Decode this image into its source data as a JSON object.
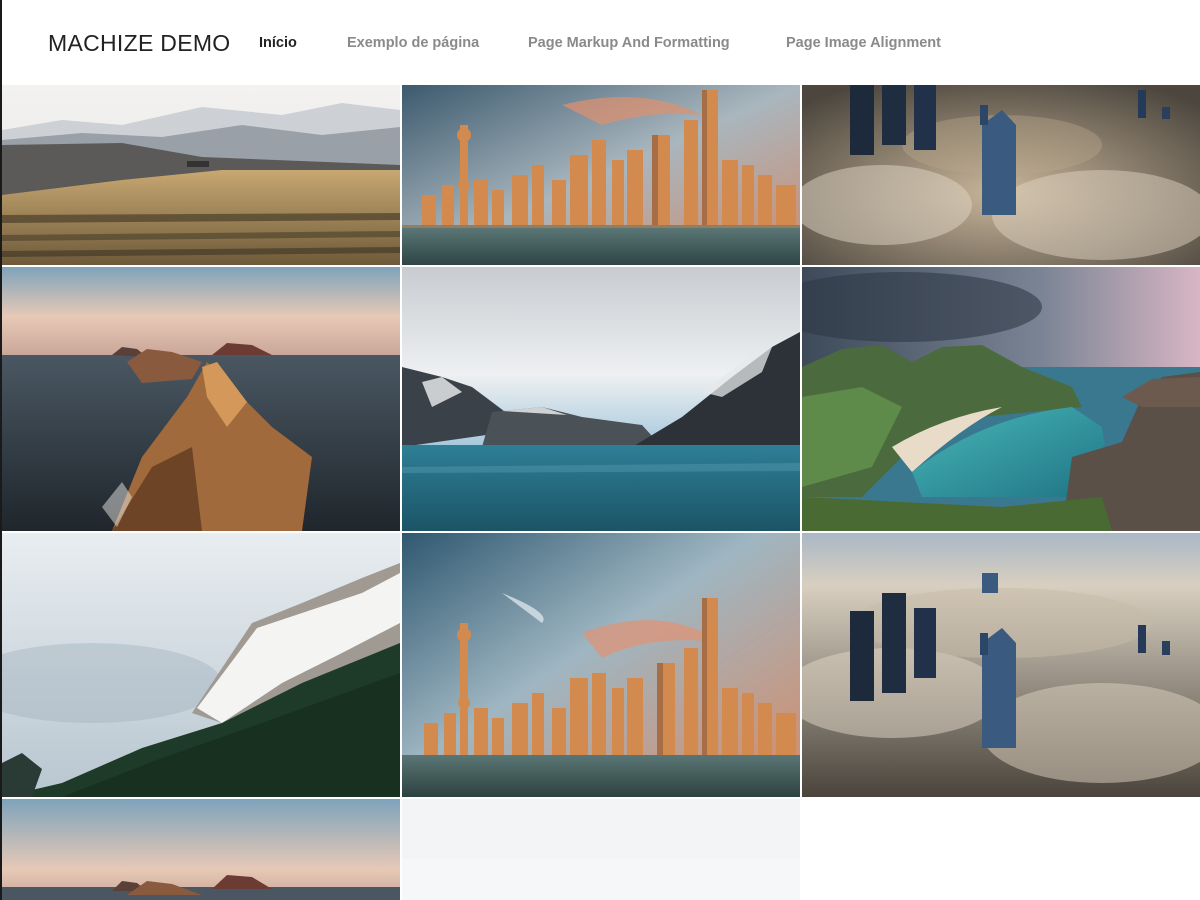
{
  "site": {
    "title": "MACHIZE DEMO"
  },
  "nav": {
    "items": [
      {
        "label": "Início",
        "active": true
      },
      {
        "label": "Exemplo de página",
        "active": false
      },
      {
        "label": "Page Markup And Formatting",
        "active": false
      },
      {
        "label": "Page Image Alignment",
        "active": false
      }
    ]
  },
  "gallery": {
    "tiles": [
      {
        "subject": "mountain meadow with snowy hills"
      },
      {
        "subject": "city skyline at sunset"
      },
      {
        "subject": "skyscrapers above clouds"
      },
      {
        "subject": "rocky islands in sea"
      },
      {
        "subject": "mountain lake with snowy peaks"
      },
      {
        "subject": "green mountains and turquoise bay"
      },
      {
        "subject": "snowy mountain slope with forest"
      },
      {
        "subject": "city skyline at sunset"
      },
      {
        "subject": "skyscrapers above clouds"
      },
      {
        "subject": "rocky islands in sea"
      },
      {
        "subject": "bright sky"
      }
    ]
  },
  "colors": {
    "accent_text": "#222222",
    "muted_text": "#8a8a8a"
  }
}
